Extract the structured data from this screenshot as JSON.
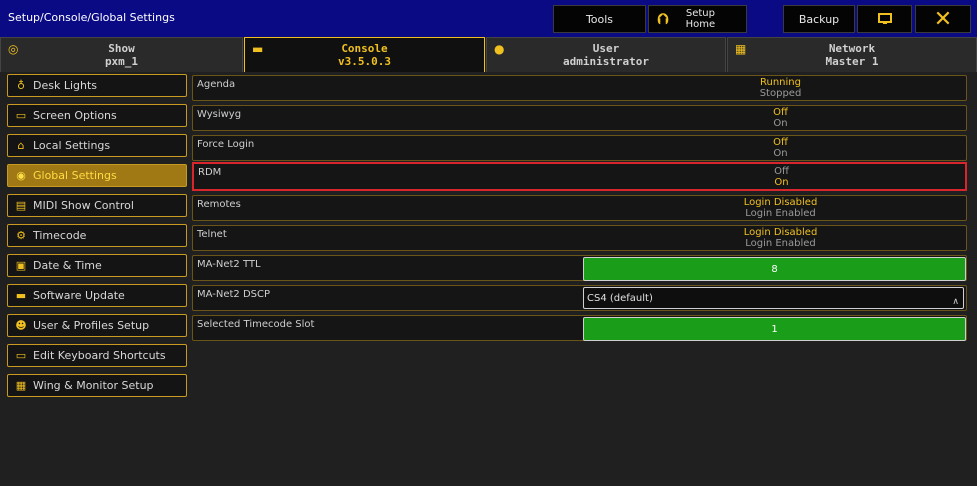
{
  "titlebar": {
    "path": "Setup/Console/Global Settings",
    "tools_label": "Tools",
    "home_label": "Setup Home",
    "backup_label": "Backup",
    "home_icon": "home-icon",
    "monitor_icon": "monitor-icon",
    "close_icon": "close-icon"
  },
  "tabs": [
    {
      "line1": "Show",
      "line2": "pxm_1",
      "icon": "show-icon"
    },
    {
      "line1": "Console",
      "line2": "v3.5.0.3",
      "icon": "console-icon"
    },
    {
      "line1": "User",
      "line2": "administrator",
      "icon": "user-icon"
    },
    {
      "line1": "Network",
      "line2": "Master 1",
      "icon": "network-icon"
    }
  ],
  "menu": [
    {
      "label": "Desk Lights",
      "icon": "lightbulb-icon"
    },
    {
      "label": "Screen Options",
      "icon": "screen-icon"
    },
    {
      "label": "Local Settings",
      "icon": "house-icon"
    },
    {
      "label": "Global Settings",
      "icon": "globe-icon"
    },
    {
      "label": "MIDI Show Control",
      "icon": "midi-icon"
    },
    {
      "label": "Timecode",
      "icon": "timecode-icon"
    },
    {
      "label": "Date & Time",
      "icon": "calendar-icon"
    },
    {
      "label": "Software Update",
      "icon": "software-icon"
    },
    {
      "label": "User & Profiles Setup",
      "icon": "users-icon"
    },
    {
      "label": "Edit Keyboard Shortcuts",
      "icon": "keyboard-icon"
    },
    {
      "label": "Wing & Monitor Setup",
      "icon": "wing-monitor-icon"
    }
  ],
  "settings": [
    {
      "label": "Agenda",
      "opt1": "Running",
      "opt2": "Stopped"
    },
    {
      "label": "Wysiwyg",
      "opt1": "Off",
      "opt2": "On"
    },
    {
      "label": "Force Login",
      "opt1": "Off",
      "opt2": "On"
    },
    {
      "label": "RDM",
      "opt1": "Off",
      "opt2": "On"
    },
    {
      "label": "Remotes",
      "opt1": "Login Disabled",
      "opt2": "Login Enabled"
    },
    {
      "label": "Telnet",
      "opt1": "Login Disabled",
      "opt2": "Login Enabled"
    },
    {
      "label": "MA-Net2 TTL",
      "value": "8"
    },
    {
      "label": "MA-Net2 DSCP",
      "value": "CS4 (default)"
    },
    {
      "label": "Selected Timecode Slot",
      "value": "1"
    }
  ],
  "colors": {
    "accent": "#f0c020",
    "titlebar": "#0a0a84",
    "selected_menu": "#a07814",
    "green_value": "#1a9e1a",
    "highlight_box": "#d8262c"
  }
}
